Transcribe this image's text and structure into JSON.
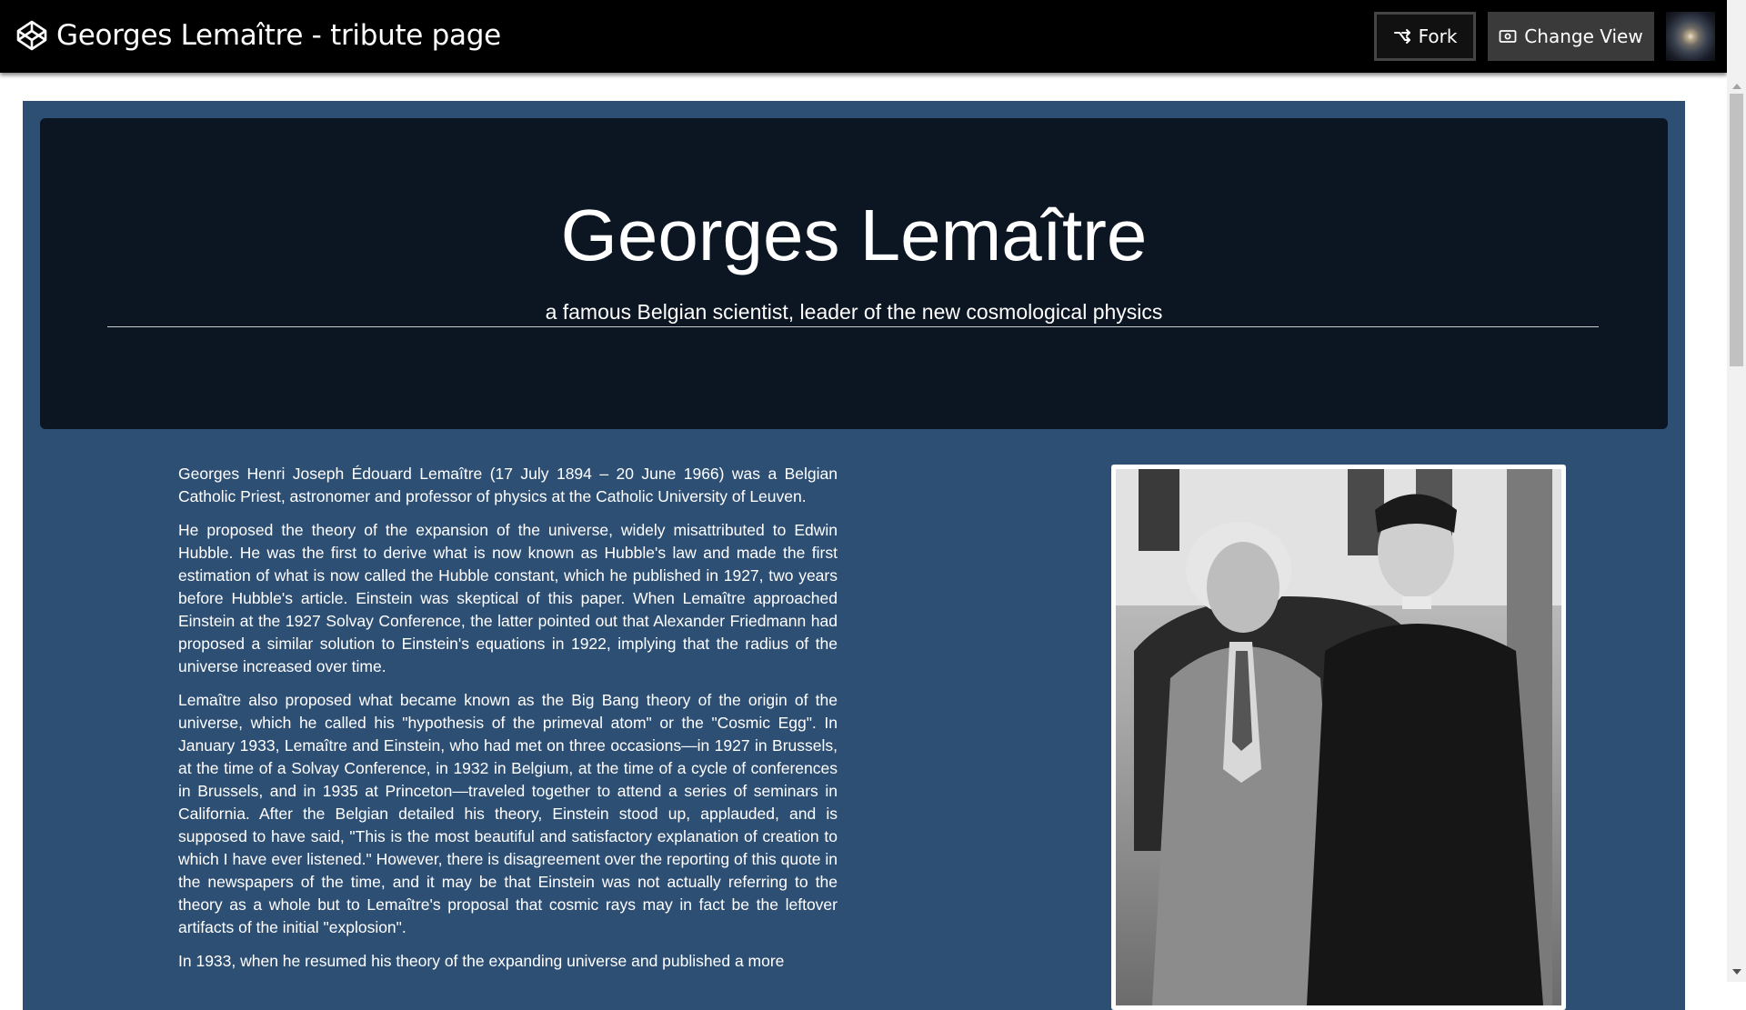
{
  "app": {
    "title": "Georges Lemaître - tribute page",
    "logo_icon": "codepen-cube-icon"
  },
  "toolbar": {
    "fork_label": "Fork",
    "fork_icon": "fork-icon",
    "change_view_label": "Change View",
    "change_view_icon": "eye-icon",
    "avatar": "user-avatar-galaxy"
  },
  "header": {
    "name": "Georges Lemaître",
    "tagline": "a famous Belgian scientist, leader of the new cosmological physics"
  },
  "bio": {
    "paragraphs": [
      "Georges Henri Joseph Édouard Lemaître (17 July 1894 – 20 June 1966) was a Belgian Catholic Priest, astronomer and professor of physics at the Catholic University of Leuven.",
      "He proposed the theory of the expansion of the universe, widely misattributed to Edwin Hubble. He was the first to derive what is now known as Hubble's law and made the first estimation of what is now called the Hubble constant, which he published in 1927, two years before Hubble's article. Einstein was skeptical of this paper. When Lemaître approached Einstein at the 1927 Solvay Conference, the latter pointed out that Alexander Friedmann had proposed a similar solution to Einstein's equations in 1922, implying that the radius of the universe increased over time.",
      "Lemaître also proposed what became known as the Big Bang theory of the origin of the universe, which he called his \"hypothesis of the primeval atom\" or the \"Cosmic Egg\". In January 1933, Lemaître and Einstein, who had met on three occasions—in 1927 in Brussels, at the time of a Solvay Conference, in 1932 in Belgium, at the time of a cycle of conferences in Brussels, and in 1935 at Princeton—traveled together to attend a series of seminars in California. After the Belgian detailed his theory, Einstein stood up, applauded, and is supposed to have said, \"This is the most beautiful and satisfactory explanation of creation to which I have ever listened.\" However, there is disagreement over the reporting of this quote in the newspapers of the time, and it may be that Einstein was not actually referring to the theory as a whole but to Lemaître's proposal that cosmic rays may in fact be the leftover artifacts of the initial \"explosion\".",
      "In 1933, when he resumed his theory of the expanding universe and published a more"
    ]
  },
  "photo": {
    "subject": "black-and-white photo of Einstein and Lemaître"
  },
  "colors": {
    "topbar": "#000000",
    "page_background": "#2e4f74",
    "header_card": "#0c1522",
    "text": "#ffffff"
  }
}
